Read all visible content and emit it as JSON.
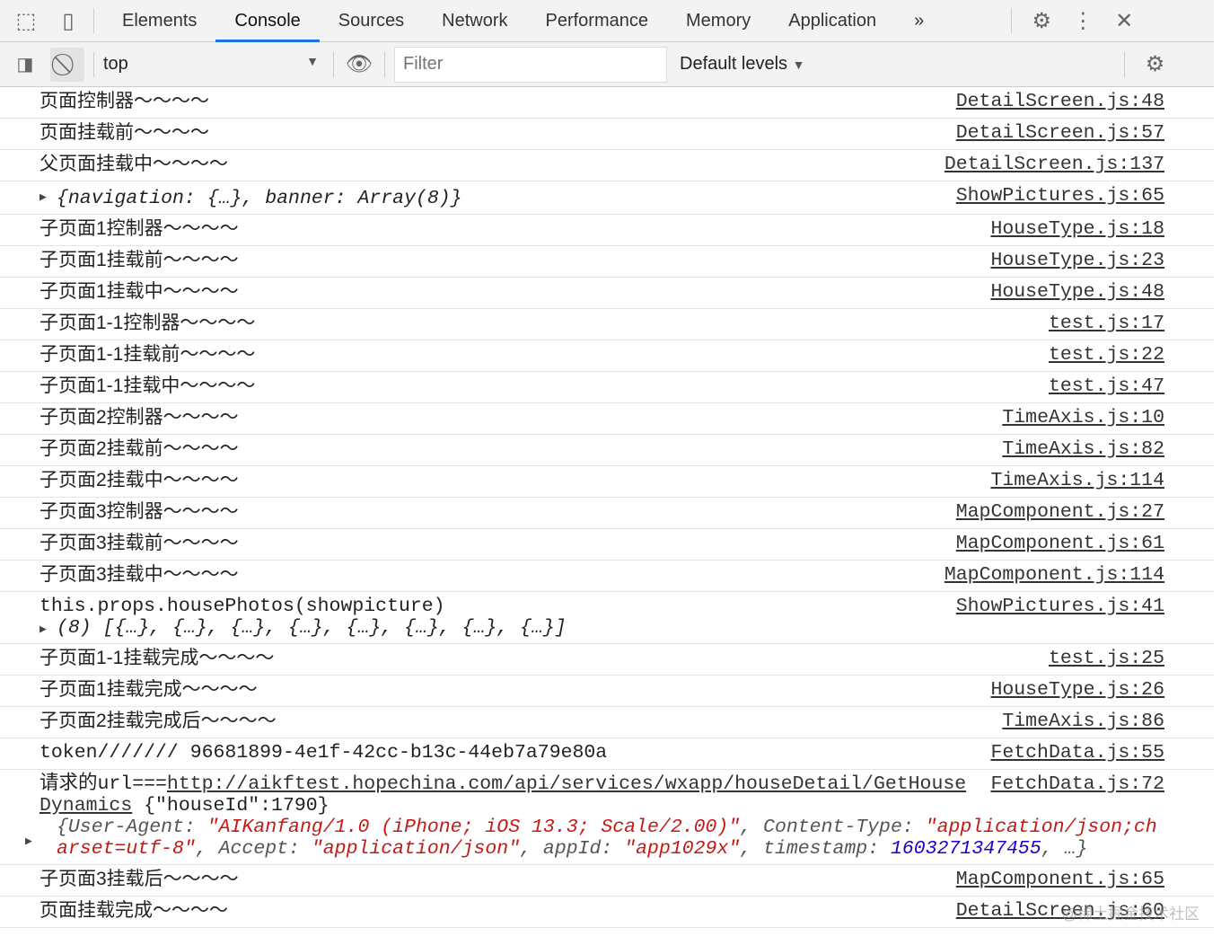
{
  "toolbar": {
    "tabs": [
      "Elements",
      "Console",
      "Sources",
      "Network",
      "Performance",
      "Memory",
      "Application"
    ],
    "active_tab": "Console",
    "more": "»"
  },
  "console_toolbar": {
    "context": "top",
    "filter_placeholder": "Filter",
    "levels": "Default levels"
  },
  "messages": [
    {
      "text": "页面控制器～～～～",
      "source": "DetailScreen.js:48"
    },
    {
      "text": "页面挂载前～～～～",
      "source": "DetailScreen.js:57"
    },
    {
      "text": "父页面挂载中～～～～",
      "source": "DetailScreen.js:137"
    },
    {
      "object": "{navigation: {…}, banner: Array(8)}",
      "source": "ShowPictures.js:65"
    },
    {
      "text": "子页面1控制器～～～～",
      "source": "HouseType.js:18"
    },
    {
      "text": "子页面1挂载前～～～～",
      "source": "HouseType.js:23"
    },
    {
      "text": "子页面1挂载中～～～～",
      "source": "HouseType.js:48"
    },
    {
      "text": "子页面1-1控制器～～～～",
      "source": "test.js:17"
    },
    {
      "text": "子页面1-1挂载前～～～～",
      "source": "test.js:22"
    },
    {
      "text": "子页面1-1挂载中～～～～",
      "source": "test.js:47"
    },
    {
      "text": "子页面2控制器～～～～",
      "source": "TimeAxis.js:10"
    },
    {
      "text": "子页面2挂载前～～～～",
      "source": "TimeAxis.js:82"
    },
    {
      "text": "子页面2挂载中～～～～",
      "source": "TimeAxis.js:114"
    },
    {
      "text": "子页面3控制器～～～～",
      "source": "MapComponent.js:27"
    },
    {
      "text": "子页面3挂载前～～～～",
      "source": "MapComponent.js:61"
    },
    {
      "text": "子页面3挂载中～～～～",
      "source": "MapComponent.js:114"
    },
    {
      "mono": "this.props.housePhotos(showpicture)",
      "object": "(8) [{…}, {…}, {…}, {…}, {…}, {…}, {…}, {…}]",
      "source": "ShowPictures.js:41"
    },
    {
      "text": "子页面1-1挂载完成～～～～",
      "source": "test.js:25"
    },
    {
      "text": "子页面1挂载完成～～～～",
      "source": "HouseType.js:26"
    },
    {
      "text": "子页面2挂载完成后～～～～",
      "source": "TimeAxis.js:86"
    },
    {
      "mono": "token/////// 96681899-4e1f-42cc-b13c-44eb7a79e80a",
      "source": "FetchData.js:55"
    },
    {
      "prefix": "请求的url===",
      "url": "http://aikftest.hopechina.com/api/services/wxapp/houseDetail/GetHouseDynamics",
      "suffix": " {\"houseId\":1790}",
      "parts": [
        {
          "t": "key",
          "v": "{User-Agent: "
        },
        {
          "t": "str",
          "v": "\"AIKanfang/1.0 (iPhone; iOS 13.3; Scale/2.00)\""
        },
        {
          "t": "key",
          "v": ", Content-Type: "
        },
        {
          "t": "str",
          "v": "\"application/json;charset=utf-8\""
        },
        {
          "t": "key",
          "v": ", Accept: "
        },
        {
          "t": "str",
          "v": "\"application/json\""
        },
        {
          "t": "key",
          "v": ", appId: "
        },
        {
          "t": "str",
          "v": "\"app1029x\""
        },
        {
          "t": "key",
          "v": ", timestamp: "
        },
        {
          "t": "num",
          "v": "1603271347455"
        },
        {
          "t": "key",
          "v": ", …}"
        }
      ],
      "source": "FetchData.js:72"
    },
    {
      "text": "子页面3挂载后～～～～",
      "source": "MapComponent.js:65"
    },
    {
      "text": "页面挂载完成～～～～",
      "source": "DetailScreen.js:60"
    }
  ],
  "watermark": "@稀土掘金技术社区"
}
